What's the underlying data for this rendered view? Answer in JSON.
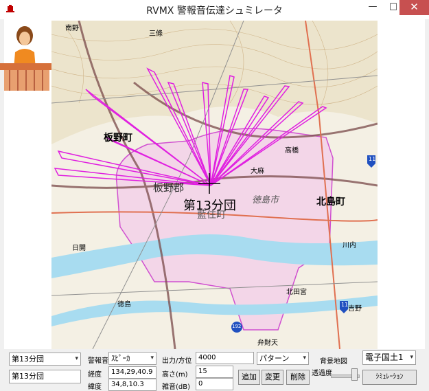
{
  "window": {
    "title": "RVMX 警報音伝達シュミレータ",
    "minimize": "—",
    "maximize": "□",
    "close": "✕"
  },
  "map": {
    "labels": {
      "itano": "板野町",
      "itano_gun": "板野郡",
      "unit": "第13分団",
      "aizumi": "藍住町",
      "tokushima": "徳島市",
      "kitajima": "北島町",
      "sanjo": "三條",
      "kashii": "大麻",
      "hiyagami": "日開",
      "takahashi": "高橋",
      "yoshino": "吉野",
      "kawauchi": "川内",
      "kitatamiya": "北田宮",
      "heiji": "徳島",
      "minami": "南野",
      "benten": "弁財天",
      "route11": "11",
      "route192": "192"
    }
  },
  "controls": {
    "unit_select": "第13分団",
    "unit_name": "第13分団",
    "alarm_label": "警報音",
    "alarm_select": "ｽﾋﾟｰｶ",
    "lon_label": "経度",
    "lon_value": "134,29,40.9",
    "lat_label": "緯度",
    "lat_value": "34,8,10.3",
    "power_label": "出力/方位",
    "power_value": "4000",
    "height_label": "高さ(m)",
    "height_value": "15",
    "noise_label": "雑音(dB)",
    "noise_value": "0",
    "pattern_select": "パターン",
    "add_button": "追加",
    "change_button": "変更",
    "delete_button": "削除",
    "bgmap_label": "背景地図",
    "bgmap_select": "電子国土1",
    "transparency_label": "透過度",
    "transparency_level": 0.85,
    "simulate_button": "ｼﾐｭﾚｰｼｮﾝ"
  }
}
